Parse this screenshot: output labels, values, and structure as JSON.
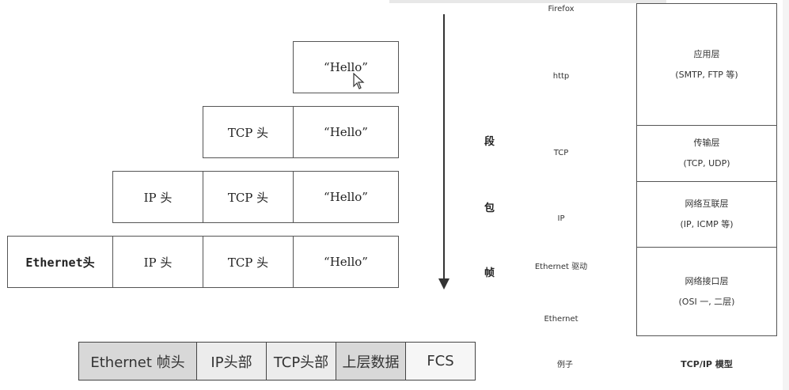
{
  "encapsulation": {
    "hello": "“Hello”",
    "tcp_header": "TCP 头",
    "ip_header": "IP 头",
    "ethernet_header": "Ethernet头"
  },
  "vertical_labels": [
    "段",
    "包",
    "帧"
  ],
  "protocol_stack": {
    "firefox": "Firefox",
    "http": "http",
    "tcp": "TCP",
    "ip": "IP",
    "ethernet_driver": "Ethernet 驱动",
    "ethernet": "Ethernet",
    "example": "例子"
  },
  "tcpip_layers": [
    {
      "name": "应用层",
      "detail": "(SMTP, FTP 等)"
    },
    {
      "name": "传输层",
      "detail": "(TCP, UDP)"
    },
    {
      "name": "网络互联层",
      "detail": "(IP, ICMP 等)"
    },
    {
      "name": "网络接口层",
      "detail": "(OSI 一, 二层)"
    }
  ],
  "model_label": "TCP/IP 模型",
  "frame_fields": [
    "Ethernet 帧头",
    "IP头部",
    "TCP头部",
    "上层数据",
    "FCS"
  ]
}
